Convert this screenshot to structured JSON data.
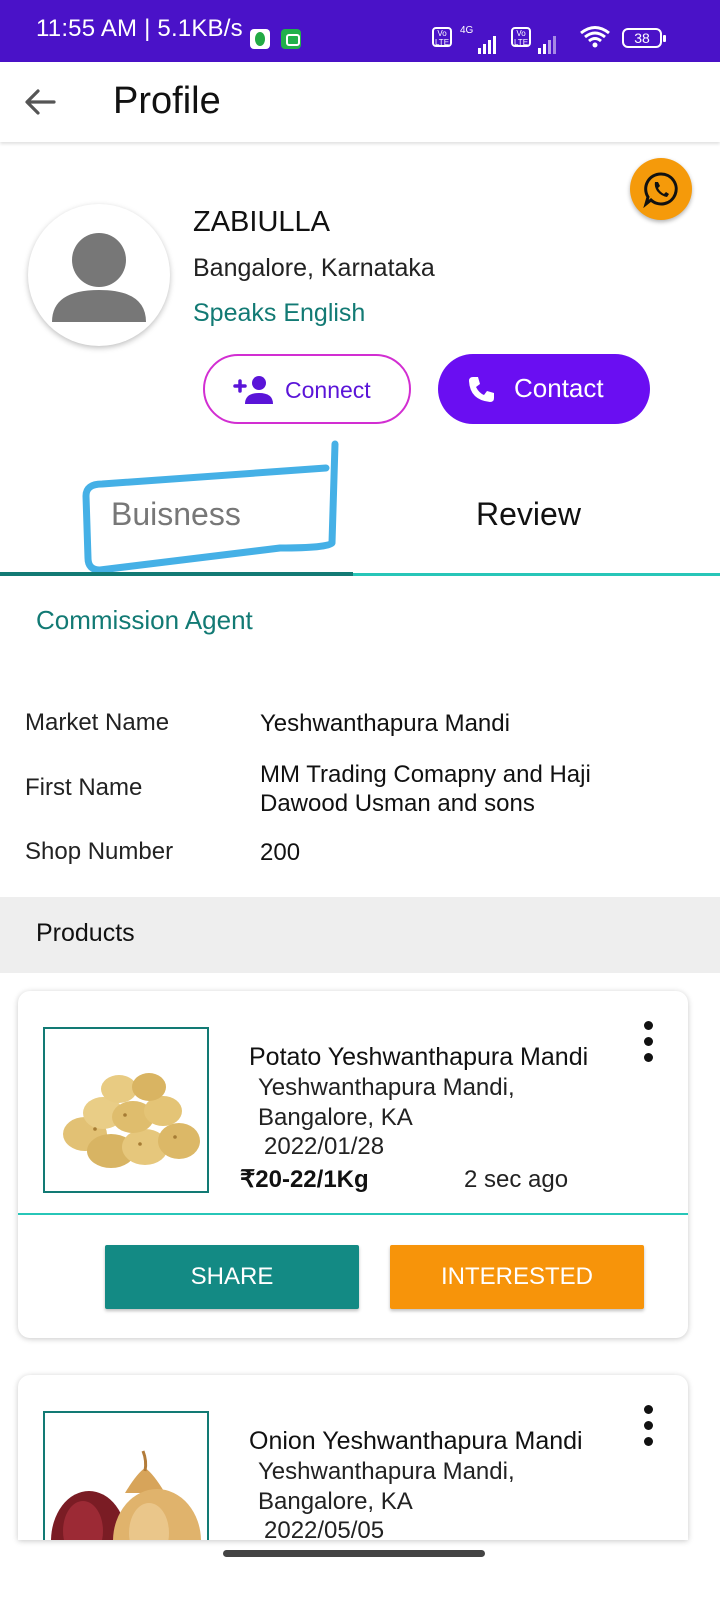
{
  "status_bar": {
    "time": "11:55 AM | 5.1KB/s",
    "network_type": "4G",
    "volte_label_1": "Vo LTE",
    "volte_label_2": "Vo LTE",
    "battery": "38"
  },
  "app_bar": {
    "title": "Profile"
  },
  "profile": {
    "name": "ZABIULLA",
    "location": "Bangalore, Karnataka",
    "speaks": "Speaks English",
    "connect_label": "Connect",
    "contact_label": "Contact"
  },
  "tabs": [
    {
      "label": "Buisness",
      "selected": true
    },
    {
      "label": "Review",
      "selected": false
    }
  ],
  "business": {
    "category": "Commission Agent",
    "fields": [
      {
        "label": "Market Name",
        "value": "Yeshwanthapura Mandi"
      },
      {
        "label": "First Name",
        "value": "MM Trading Comapny and Haji Dawood Usman and sons"
      },
      {
        "label": "Shop Number",
        "value": "200"
      }
    ]
  },
  "products": {
    "header": "Products",
    "items": [
      {
        "title": "Potato Yeshwanthapura Mandi",
        "market": "Yeshwanthapura Mandi,",
        "city": "Bangalore, KA",
        "date": "2022/01/28",
        "price": "₹20-22/1Kg",
        "posted": "2 sec ago",
        "share_label": "SHARE",
        "interested_label": "INTERESTED"
      },
      {
        "title": "Onion Yeshwanthapura Mandi",
        "market": "Yeshwanthapura Mandi,",
        "city": "Bangalore, KA",
        "date": "2022/05/05"
      }
    ]
  },
  "colors": {
    "status_bar": "#4a12c8",
    "teal": "#127a74",
    "contact_purple": "#6a0ef2",
    "interested_orange": "#f7940a",
    "whatsapp_fab": "#f59a0a",
    "highlight_stroke": "#45b0e6"
  },
  "icons": [
    "back-arrow-icon",
    "whatsapp-icon",
    "person-icon",
    "person-add-icon",
    "phone-icon",
    "more-vert-icon"
  ]
}
